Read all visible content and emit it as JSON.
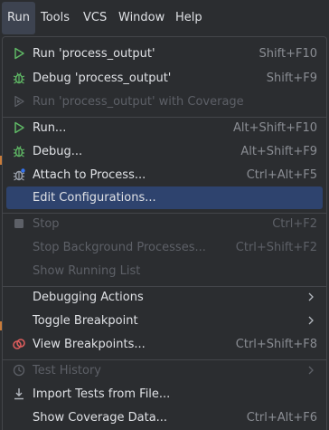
{
  "menubar": {
    "items": [
      {
        "label": "Run"
      },
      {
        "label": "Tools"
      },
      {
        "label": "VCS"
      },
      {
        "label": "Window"
      },
      {
        "label": "Help"
      }
    ]
  },
  "menu": {
    "items": [
      {
        "label": "Run 'process_output'",
        "shortcut": "Shift+F10",
        "icon": "run-icon",
        "enabled": true
      },
      {
        "label": "Debug 'process_output'",
        "shortcut": "Shift+F9",
        "icon": "debug-icon",
        "enabled": true
      },
      {
        "label": "Run 'process_output' with Coverage",
        "shortcut": "",
        "icon": "coverage-icon",
        "enabled": false
      },
      {
        "label": "Run...",
        "shortcut": "Alt+Shift+F10",
        "icon": "run-icon",
        "enabled": true
      },
      {
        "label": "Debug...",
        "shortcut": "Alt+Shift+F9",
        "icon": "debug-icon",
        "enabled": true
      },
      {
        "label": "Attach to Process...",
        "shortcut": "Ctrl+Alt+F5",
        "icon": "attach-process-icon",
        "enabled": true
      },
      {
        "label": "Edit Configurations...",
        "shortcut": "",
        "icon": "",
        "enabled": true,
        "highlighted": true
      },
      {
        "label": "Stop",
        "shortcut": "Ctrl+F2",
        "icon": "stop-icon",
        "enabled": false
      },
      {
        "label": "Stop Background Processes...",
        "shortcut": "Ctrl+Shift+F2",
        "icon": "",
        "enabled": false
      },
      {
        "label": "Show Running List",
        "shortcut": "",
        "icon": "",
        "enabled": false
      },
      {
        "label": "Debugging Actions",
        "shortcut": "",
        "icon": "",
        "enabled": true,
        "submenu": true
      },
      {
        "label": "Toggle Breakpoint",
        "shortcut": "",
        "icon": "",
        "enabled": true,
        "submenu": true
      },
      {
        "label": "View Breakpoints...",
        "shortcut": "Ctrl+Shift+F8",
        "icon": "breakpoints-icon",
        "enabled": true
      },
      {
        "label": "Test History",
        "shortcut": "",
        "icon": "history-icon",
        "enabled": false,
        "submenu": true
      },
      {
        "label": "Import Tests from File...",
        "shortcut": "",
        "icon": "import-icon",
        "enabled": true
      },
      {
        "label": "Show Coverage Data...",
        "shortcut": "Ctrl+Alt+F6",
        "icon": "",
        "enabled": true
      }
    ]
  },
  "colors": {
    "background": "#2b2d30",
    "highlight": "#2e436e",
    "text": "#dfe1e5",
    "disabled_text": "#5d6067",
    "shortcut_text": "#8a8d93",
    "run_green": "#5fb865",
    "breakpoint_red": "#db5c5c"
  }
}
